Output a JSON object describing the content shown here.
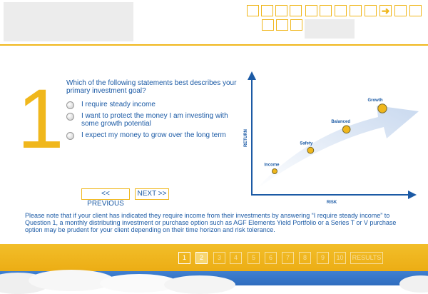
{
  "question": {
    "number": "1",
    "text": "Which of the following statements best describes your primary investment goal?",
    "options": [
      "I require steady income",
      "I want to protect the money I am investing with some growth potential",
      "I expect my money to grow over the long term"
    ]
  },
  "nav": {
    "previous_label": "<< PREVIOUS",
    "next_label": "NEXT >>"
  },
  "chart_data": {
    "type": "scatter",
    "xlabel": "RISK",
    "ylabel": "RETURN",
    "points": [
      {
        "label": "Income",
        "x": 1,
        "y": 1
      },
      {
        "label": "Safety",
        "x": 2,
        "y": 2
      },
      {
        "label": "Balanced",
        "x": 3,
        "y": 3
      },
      {
        "label": "Growth",
        "x": 4,
        "y": 4
      }
    ],
    "grid": false,
    "colors": {
      "axis": "#1b5aa5",
      "arrow": "#d7e3f3",
      "point": "#f0b71c",
      "label": "#1b5aa5"
    }
  },
  "note": "Please note that if your client has indicated they require income from their investments by answering “I require steady income” to Question 1, a monthly distributing investment or purchase option such as AGF Elements Yield Portfolio or a Series T or V purchase option may be prudent for your client depending on their time horizon and risk tolerance.",
  "pagination": {
    "pages": [
      "1",
      "2",
      "3",
      "4",
      "5",
      "6",
      "7",
      "8",
      "9",
      "10"
    ],
    "results_label": "RESULTS",
    "current": "2"
  },
  "header_nav": {
    "arrow_icon": "right-arrow-icon"
  },
  "colors": {
    "accent": "#f0b71c",
    "text": "#1b5aa5"
  }
}
